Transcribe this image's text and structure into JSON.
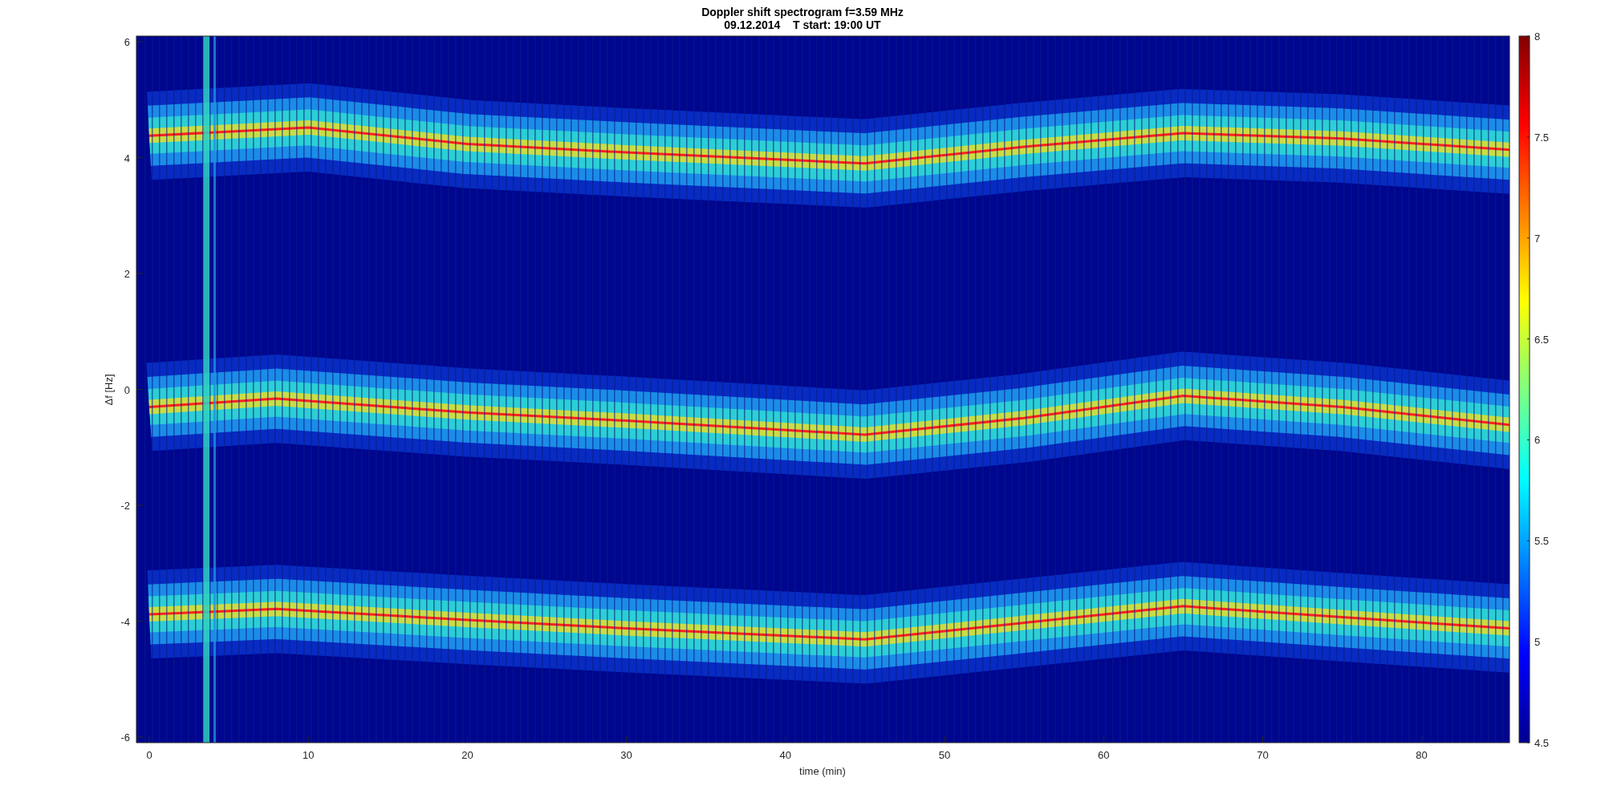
{
  "figure": {
    "title": [
      "Doppler shift spectrogram f=3.59 MHz",
      "09.12.2014    T start: 19:00 UT"
    ],
    "xlabel": "time (min)",
    "ylabel": "Δf [Hz]",
    "xticks": [
      "0",
      "10",
      "20",
      "30",
      "40",
      "50",
      "60",
      "70",
      "80"
    ],
    "yticks": [
      "6",
      "4",
      "2",
      "0",
      "-2",
      "-4",
      "-6"
    ],
    "colorbar": {
      "ticks": [
        "8",
        "7.5",
        "7",
        "6.5",
        "6",
        "5.5",
        "5",
        "4.5"
      ]
    }
  }
}
